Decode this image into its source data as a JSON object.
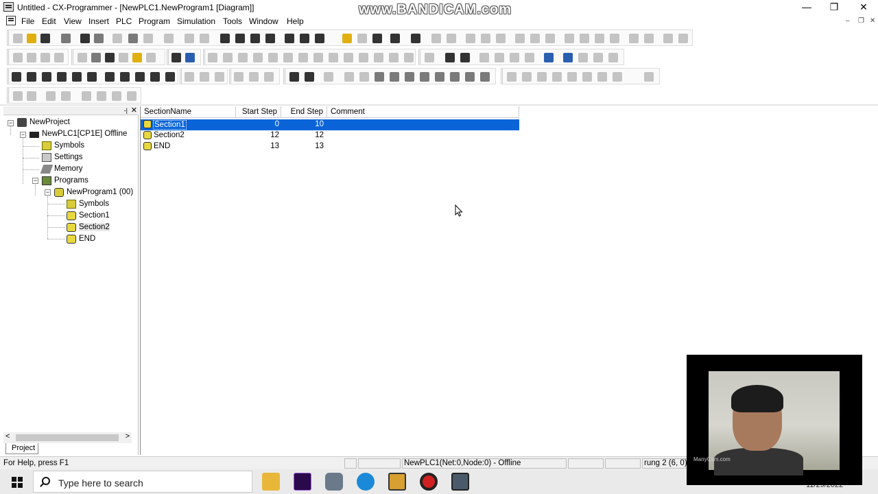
{
  "window": {
    "title": "Untitled - CX-Programmer - [NewPLC1.NewProgram1 [Diagram]]",
    "watermark": "www.BANDICAM.com",
    "minimize_glyph": "—",
    "restore_glyph": "❐",
    "close_glyph": "✕"
  },
  "menubar": {
    "items": [
      "File",
      "Edit",
      "View",
      "Insert",
      "PLC",
      "Program",
      "Simulation",
      "Tools",
      "Window",
      "Help"
    ],
    "mdi_minimize": "–",
    "mdi_restore": "❐",
    "mdi_close": "✕"
  },
  "tree": {
    "pin_glyph": "-|",
    "close_glyph": "✕",
    "nodes": [
      {
        "label": "NewProject",
        "icon": "project-icon"
      },
      {
        "label": "NewPLC1[CP1E] Offline",
        "icon": "plc-icon"
      },
      {
        "label": "Symbols",
        "icon": "symbols-icon"
      },
      {
        "label": "Settings",
        "icon": "settings-icon"
      },
      {
        "label": "Memory",
        "icon": "memory-icon"
      },
      {
        "label": "Programs",
        "icon": "programs-icon"
      },
      {
        "label": "NewProgram1 (00)",
        "icon": "program-icon"
      },
      {
        "label": "Symbols",
        "icon": "symbols-icon"
      },
      {
        "label": "Section1",
        "icon": "section-icon"
      },
      {
        "label": "Section2",
        "icon": "section-icon"
      },
      {
        "label": "END",
        "icon": "section-icon"
      }
    ],
    "expander_minus": "−",
    "scroll_left": "<",
    "scroll_right": ">",
    "tab_label": "Project"
  },
  "sections_table": {
    "columns": [
      "SectionName",
      "Start Step",
      "End Step",
      "Comment"
    ],
    "rows": [
      {
        "name": "Section1",
        "start": "0",
        "end": "10",
        "comment": "",
        "selected": true
      },
      {
        "name": "Section2",
        "start": "12",
        "end": "12",
        "comment": "",
        "selected": false
      },
      {
        "name": "END",
        "start": "13",
        "end": "13",
        "comment": "",
        "selected": false
      }
    ]
  },
  "statusbar": {
    "help": "For Help, press F1",
    "connection": "NewPLC1(Net:0,Node:0) - Offline",
    "position": "rung 2 (6, 0)"
  },
  "taskbar": {
    "search_placeholder": "Type here to search",
    "date": "11/29/2022",
    "apps": [
      "file-explorer-icon",
      "premiere-icon",
      "camera-icon",
      "edge-icon",
      "cx-programmer-icon",
      "bandicam-record-icon",
      "network-icon"
    ]
  },
  "webcam": {
    "label": "ManyCam.com"
  },
  "colors": {
    "selection": "#0a64d8",
    "section_icon": "#e8d840"
  }
}
